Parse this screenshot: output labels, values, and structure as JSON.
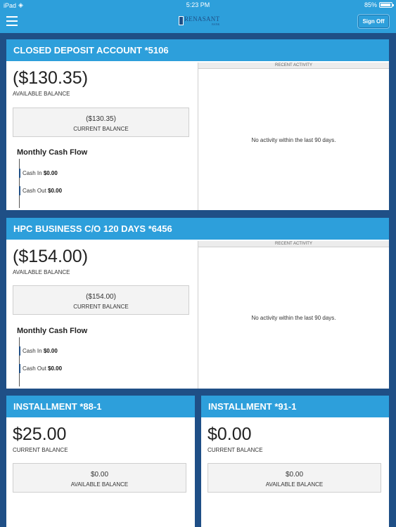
{
  "status_bar": {
    "device": "iPad",
    "time": "5:23 PM",
    "battery": "85%"
  },
  "nav": {
    "logo_text": "RENASANT",
    "logo_sub": "BANK",
    "sign_off": "Sign Off"
  },
  "accounts": [
    {
      "title": "CLOSED DEPOSIT ACCOUNT *5106",
      "primary_amount": "($130.35)",
      "primary_label": "AVAILABLE BALANCE",
      "secondary_amount": "($130.35)",
      "secondary_label": "CURRENT BALANCE",
      "cashflow_title": "Monthly Cash Flow",
      "cash_in_label": "Cash In",
      "cash_in_value": "$0.00",
      "cash_out_label": "Cash Out",
      "cash_out_value": "$0.00",
      "activity_header": "RECENT ACTIVITY",
      "activity_empty": "No activity within the last 90 days."
    },
    {
      "title": "HPC BUSINESS C/O 120 DAYS *6456",
      "primary_amount": "($154.00)",
      "primary_label": "AVAILABLE BALANCE",
      "secondary_amount": "($154.00)",
      "secondary_label": "CURRENT BALANCE",
      "cashflow_title": "Monthly Cash Flow",
      "cash_in_label": "Cash In",
      "cash_in_value": "$0.00",
      "cash_out_label": "Cash Out",
      "cash_out_value": "$0.00",
      "activity_header": "RECENT ACTIVITY",
      "activity_empty": "No activity within the last 90 days."
    },
    {
      "title": "INSTALLMENT *88-1",
      "primary_amount": "$25.00",
      "primary_label": "CURRENT BALANCE",
      "secondary_amount": "$0.00",
      "secondary_label": "AVAILABLE BALANCE"
    },
    {
      "title": "INSTALLMENT *91-1",
      "primary_amount": "$0.00",
      "primary_label": "CURRENT BALANCE",
      "secondary_amount": "$0.00",
      "secondary_label": "AVAILABLE BALANCE"
    }
  ]
}
